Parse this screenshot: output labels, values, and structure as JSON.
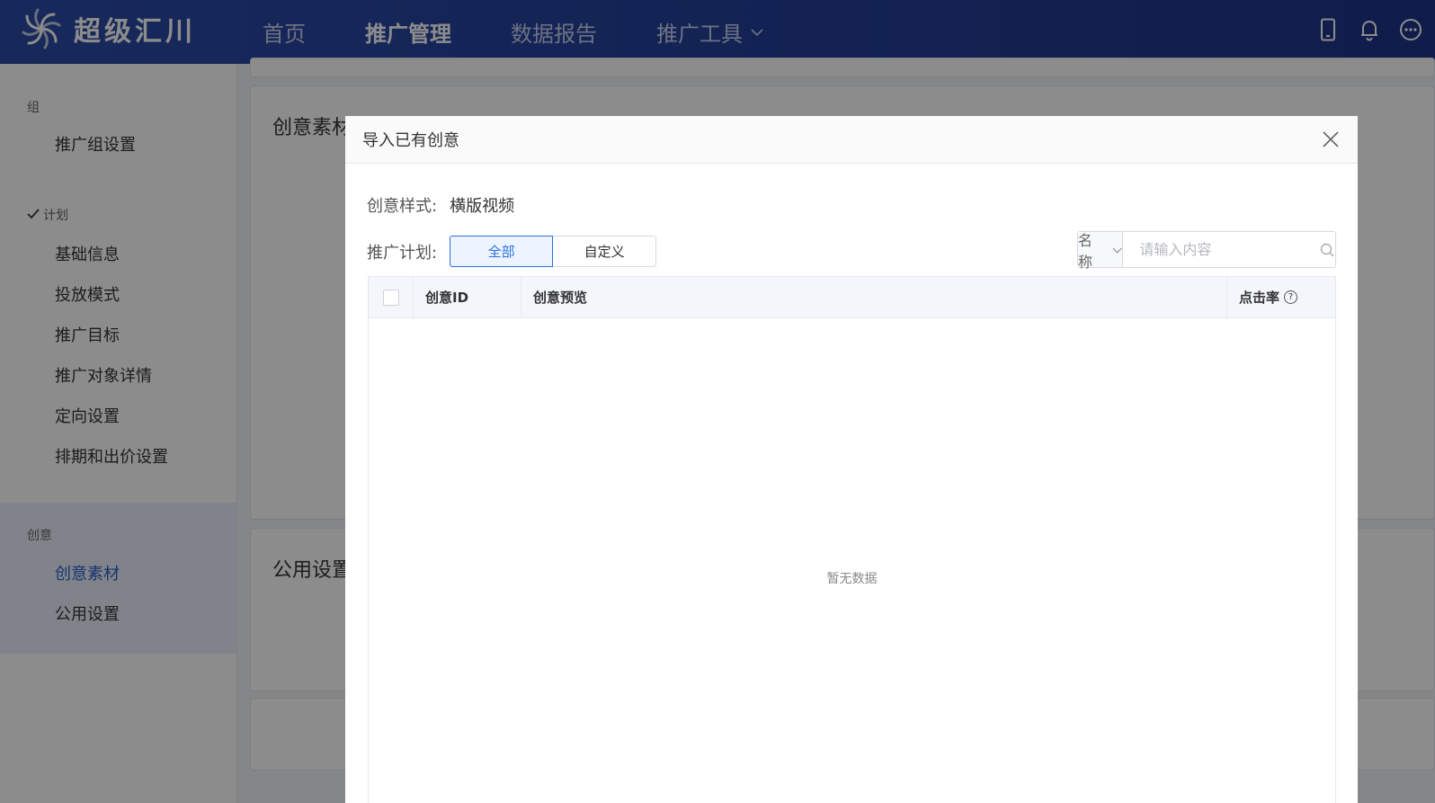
{
  "app": {
    "logo_text": "超级汇川"
  },
  "nav": {
    "items": [
      "首页",
      "推广管理",
      "数据报告",
      "推广工具"
    ]
  },
  "sidebar": {
    "group_1": "组",
    "item_group_settings": "推广组设置",
    "group_2": "计划",
    "plan_items": [
      "基础信息",
      "投放模式",
      "推广目标",
      "推广对象详情",
      "定向设置",
      "排期和出价设置"
    ],
    "group_3": "创意",
    "creative_items": [
      "创意素材",
      "公用设置"
    ]
  },
  "main": {
    "card_1_title": "创意素材",
    "card_2_title": "公用设置"
  },
  "modal": {
    "title": "导入已有创意",
    "style_label": "创意样式:",
    "style_value": "横版视频",
    "plan_label": "推广计划:",
    "plan_options": [
      "全部",
      "自定义"
    ],
    "search_select": "名称",
    "search_placeholder": "请输入内容",
    "columns": [
      "创意ID",
      "创意预览",
      "点击率"
    ],
    "empty_text": "暂无数据"
  }
}
